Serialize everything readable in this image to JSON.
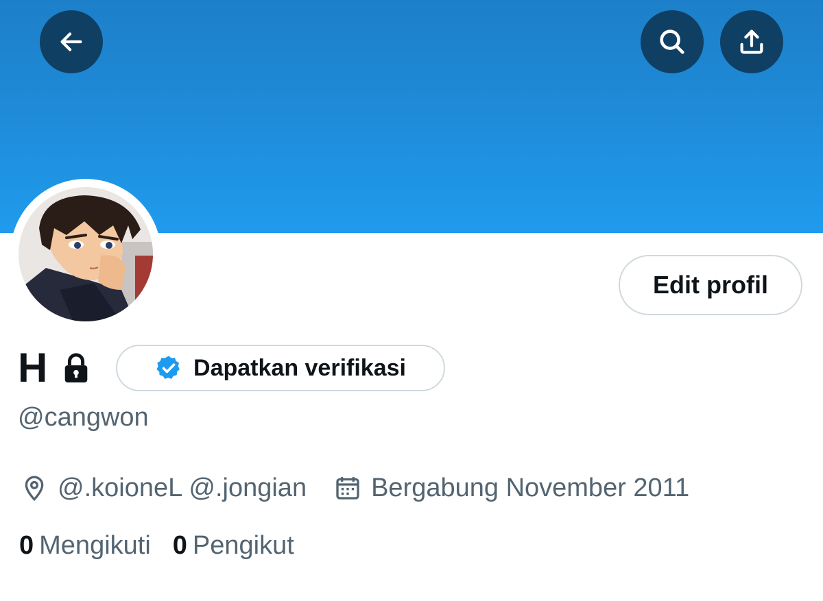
{
  "colors": {
    "banner_top": "#1d7fc9",
    "banner_bottom": "#1f9bed",
    "overlay_button": "#0f3f63",
    "verified_blue": "#1d9bf0",
    "text_primary": "#0f1419",
    "text_secondary": "#536471",
    "border": "#cfd9de"
  },
  "header": {
    "back_icon": "arrow-left-icon",
    "search_icon": "search-icon",
    "share_icon": "share-upload-icon"
  },
  "profile": {
    "avatar_icon": "anime-character-avatar",
    "edit_button_label": "Edit profil",
    "display_name": "H",
    "lock_icon": "lock-icon",
    "verify_button_label": "Dapatkan verifikasi",
    "handle": "@cangwon",
    "location_icon": "location-pin-icon",
    "location": "@.koioneL @.jongian",
    "join_icon": "calendar-icon",
    "joined": "Bergabung November 2011"
  },
  "stats": {
    "following_count": "0",
    "following_label": "Mengikuti",
    "followers_count": "0",
    "followers_label": "Pengikut"
  }
}
